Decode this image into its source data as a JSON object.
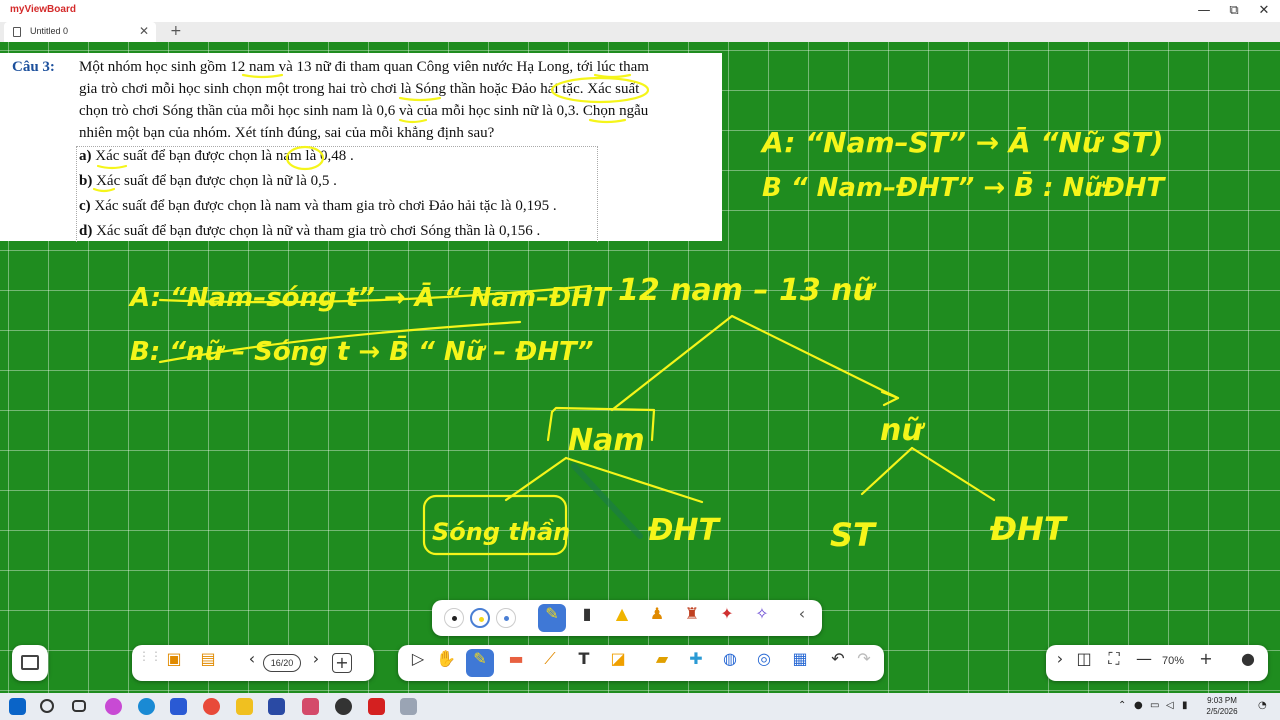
{
  "app": {
    "logo_text": "myViewBoard",
    "tab_title": "Untitled 0",
    "tab_close": "✕",
    "tab_add": "+",
    "window_controls": [
      "—",
      "⧉",
      "✕"
    ]
  },
  "question": {
    "label": "Câu 3:",
    "lines": [
      "Một nhóm học sinh gồm 12 nam và 13 nữ đi tham quan Công viên nước Hạ Long, tới lúc tham",
      "gia trò chơi mỗi học sinh chọn một trong hai trò chơi là Sóng thần hoặc Đảo hải tặc. Xác suất",
      "chọn trò chơi Sóng thần của mỗi học sinh nam là 0,6 và của mỗi học sinh nữ là 0,3. Chọn ngẫu",
      "nhiên một bạn của nhóm. Xét tính đúng, sai của mỗi khẳng định sau?"
    ],
    "options": [
      {
        "key": "a)",
        "text": "Xác suất để bạn được chọn là nam là 0,48 ."
      },
      {
        "key": "b)",
        "text": "Xác suất để bạn được chọn là nữ là 0,5 ."
      },
      {
        "key": "c)",
        "text": "Xác suất để bạn được chọn là nam và tham gia trò chơi Đảo hải tặc là 0,195 ."
      },
      {
        "key": "d)",
        "text": "Xác suất để bạn được chọn là nữ và tham gia trò chơi Sóng thần là 0,156 ."
      }
    ]
  },
  "handwriting": {
    "right_line1": "A: “Nam–ST” → Ā “Nữ ST)",
    "right_line2": "B “ Nam–ĐHT” → B̄ : NữĐHT",
    "left_line1": "A: “Nam–sóng t” → Ā “ Nam–ĐHT",
    "left_line2": "B: “nữ – Sóng t → B̄ “ Nữ – ĐHT”",
    "tree_root": "12 nam – 13 nữ",
    "tree_nam": "Nam",
    "tree_nu": "nữ",
    "leaf_songthan": "Sóng thần",
    "leaf_dht1": "ĐHT",
    "leaf_st": "ST",
    "leaf_dht2": "ĐHT",
    "ink_color": "#f5f51a"
  },
  "toolbar": {
    "page_indicator": "16/20",
    "zoom_level": "70%",
    "icons": {
      "prev": "‹",
      "next": "›",
      "add_page": "+",
      "collapse": "‹",
      "expand": "›",
      "zoom_out": "—",
      "zoom_in": "+"
    }
  },
  "taskbar": {
    "time": "9:03 PM",
    "date": "2/5/2026"
  }
}
